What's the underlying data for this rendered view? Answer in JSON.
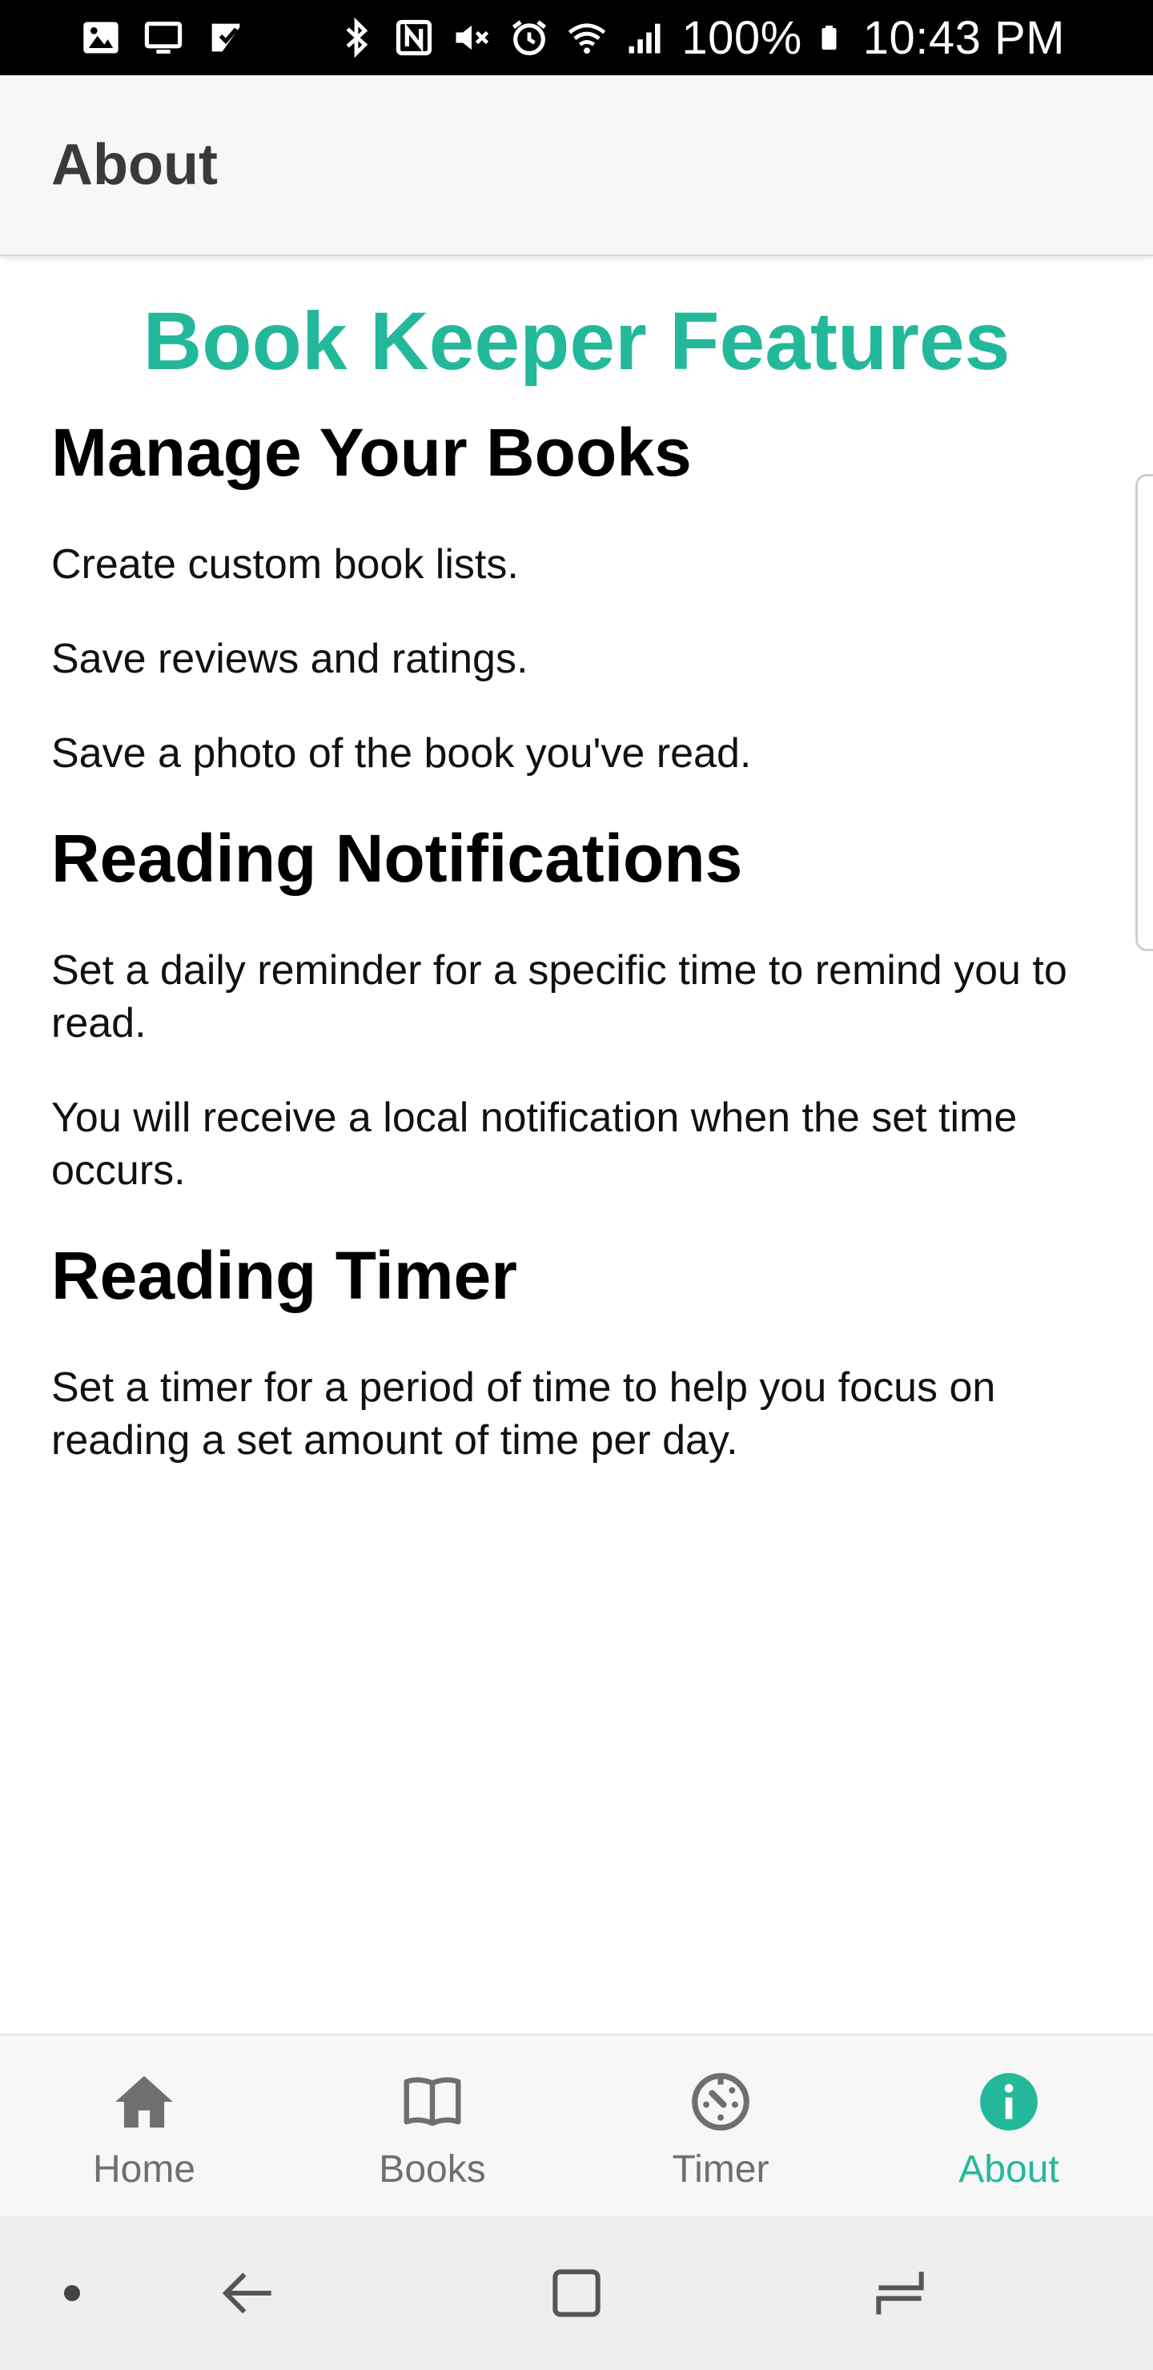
{
  "status_bar": {
    "battery": "100%",
    "time": "10:43 PM"
  },
  "header": {
    "title": "About"
  },
  "content": {
    "feature_title": "Book Keeper Features",
    "sections": [
      {
        "heading": "Manage Your Books",
        "paragraphs": [
          "Create custom book lists.",
          "Save reviews and ratings.",
          "Save a photo of the book you've read."
        ]
      },
      {
        "heading": "Reading Notifications",
        "paragraphs": [
          "Set a daily reminder for a specific time to remind you to read.",
          "You will receive a local notification when the set time occurs."
        ]
      },
      {
        "heading": "Reading Timer",
        "paragraphs": [
          "Set a timer for a period of time to help you focus on reading a set amount of time per day."
        ]
      }
    ]
  },
  "bottom_nav": {
    "items": [
      {
        "label": "Home",
        "icon": "home-icon",
        "active": false
      },
      {
        "label": "Books",
        "icon": "book-icon",
        "active": false
      },
      {
        "label": "Timer",
        "icon": "timer-icon",
        "active": false
      },
      {
        "label": "About",
        "icon": "info-icon",
        "active": true
      }
    ]
  },
  "colors": {
    "accent": "#24b89b",
    "inactive": "#6f6f6f",
    "status_bar_bg": "#000000"
  }
}
